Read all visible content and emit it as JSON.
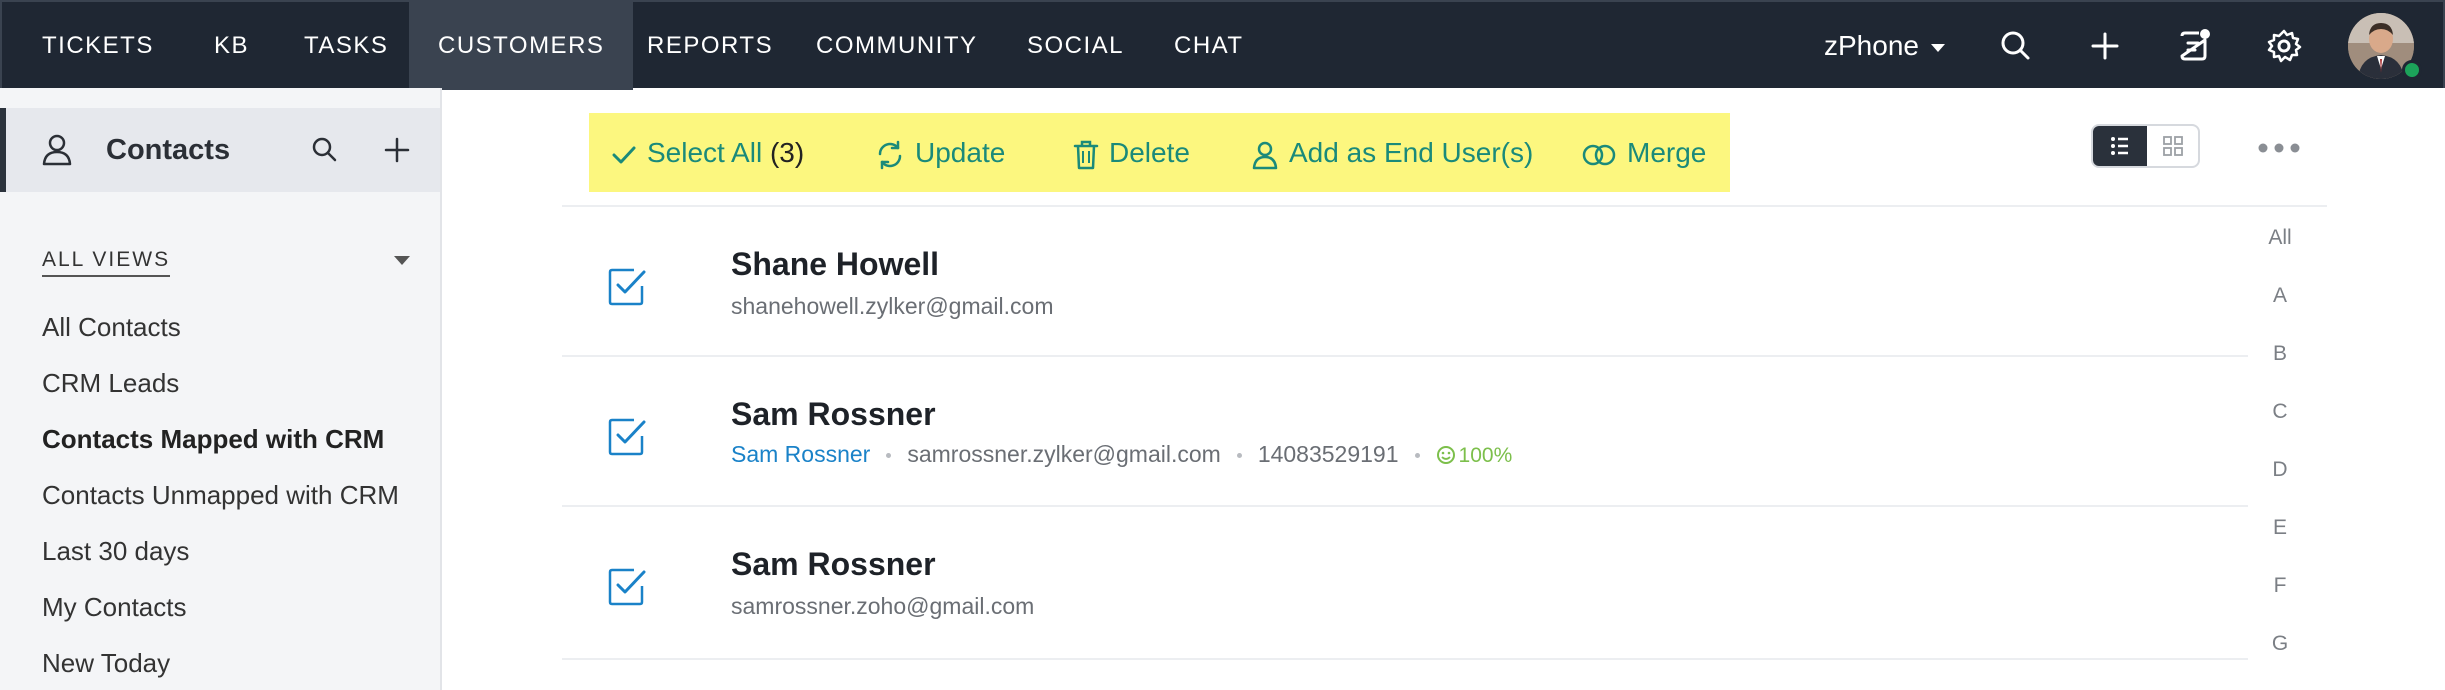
{
  "topnav": {
    "items": [
      "TICKETS",
      "KB",
      "TASKS",
      "CUSTOMERS",
      "REPORTS",
      "COMMUNITY",
      "SOCIAL",
      "CHAT"
    ],
    "active": "CUSTOMERS",
    "department": "zPhone",
    "icons": [
      "search-icon",
      "plus-icon",
      "notes-icon",
      "gear-icon"
    ]
  },
  "sidebar": {
    "title": "Contacts",
    "views_label": "ALL VIEWS",
    "views": [
      "All Contacts",
      "CRM Leads",
      "Contacts Mapped with CRM",
      "Contacts Unmapped with CRM",
      "Last 30 days",
      "My Contacts",
      "New Today"
    ],
    "active_view": "Contacts Mapped with CRM"
  },
  "toolbar": {
    "select_all": "Select All",
    "count": "(3)",
    "update": "Update",
    "delete": "Delete",
    "add_end_user": "Add as End User(s)",
    "merge": "Merge"
  },
  "contacts": [
    {
      "name": "Shane Howell",
      "email": "shanehowell.zylker@gmail.com",
      "checked": true
    },
    {
      "name": "Sam Rossner",
      "account": "Sam Rossner",
      "email": "samrossner.zylker@gmail.com",
      "phone": "14083529191",
      "happiness": "100%",
      "checked": true
    },
    {
      "name": "Sam Rossner",
      "email": "samrossner.zoho@gmail.com",
      "checked": true
    }
  ],
  "alphabet": [
    "All",
    "A",
    "B",
    "C",
    "D",
    "E",
    "F",
    "G"
  ],
  "colors": {
    "topbar": "#1f2733",
    "accent": "#1a8a7a",
    "toolbar_highlight": "#fcf77f",
    "checkbox": "#1a82c8",
    "link": "#1a82c8"
  }
}
